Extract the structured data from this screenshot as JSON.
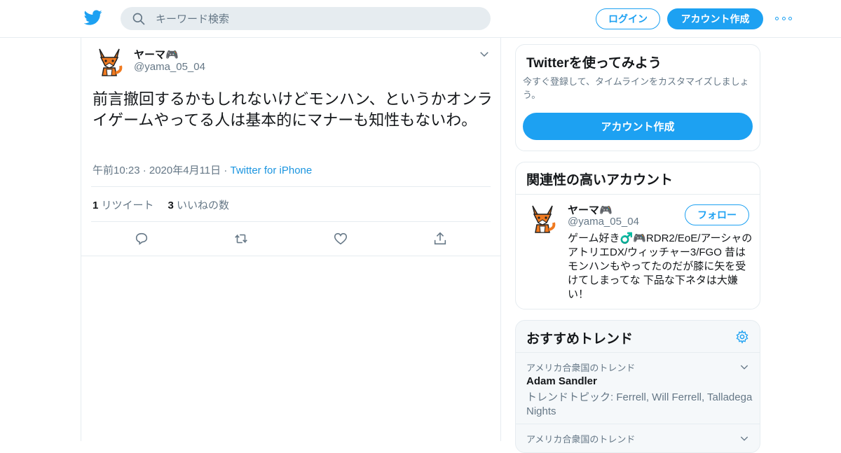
{
  "header": {
    "search_placeholder": "キーワード検索",
    "login_label": "ログイン",
    "signup_label": "アカウント作成",
    "accent_color": "#1da1f2"
  },
  "tweet": {
    "display_name": "ヤーマ🎮",
    "handle": "@yama_05_04",
    "text": "前言撤回するかもしれないけどモンハン、というかオンライゲームやってる人は基本的にマナーも知性もないわ。",
    "timestamp": "午前10:23 · 2020年4月11日",
    "separator": " · ",
    "source": "Twitter for iPhone",
    "retweet_count": "1",
    "retweet_label": "リツイート",
    "like_count": "3",
    "like_label": "いいねの数",
    "actions": [
      "reply-icon",
      "retweet-icon",
      "like-icon",
      "share-icon"
    ]
  },
  "sidebar": {
    "signup_card": {
      "title": "Twitterを使ってみよう",
      "description": "今すぐ登録して、タイムラインをカスタマイズしましょう。",
      "button_label": "アカウント作成"
    },
    "related": {
      "title": "関連性の高いアカウント",
      "account": {
        "display_name": "ヤーマ🎮",
        "handle": "@yama_05_04",
        "follow_label": "フォロー",
        "bio": "ゲーム好き♂️🎮RDR2/EoE/アーシャのアトリエDX/ウィッチャー3/FGO 昔はモンハンもやってたのだが膝に矢を受けてしまってな 下品な下ネタは大嫌い！"
      }
    },
    "trends": {
      "title": "おすすめトレンド",
      "items": [
        {
          "context": "アメリカ合衆国のトレンド",
          "name": "Adam Sandler",
          "topic": "トレンドトピック: Ferrell, Will Ferrell, Talladega Nights"
        },
        {
          "context": "アメリカ合衆国のトレンド"
        }
      ]
    }
  }
}
